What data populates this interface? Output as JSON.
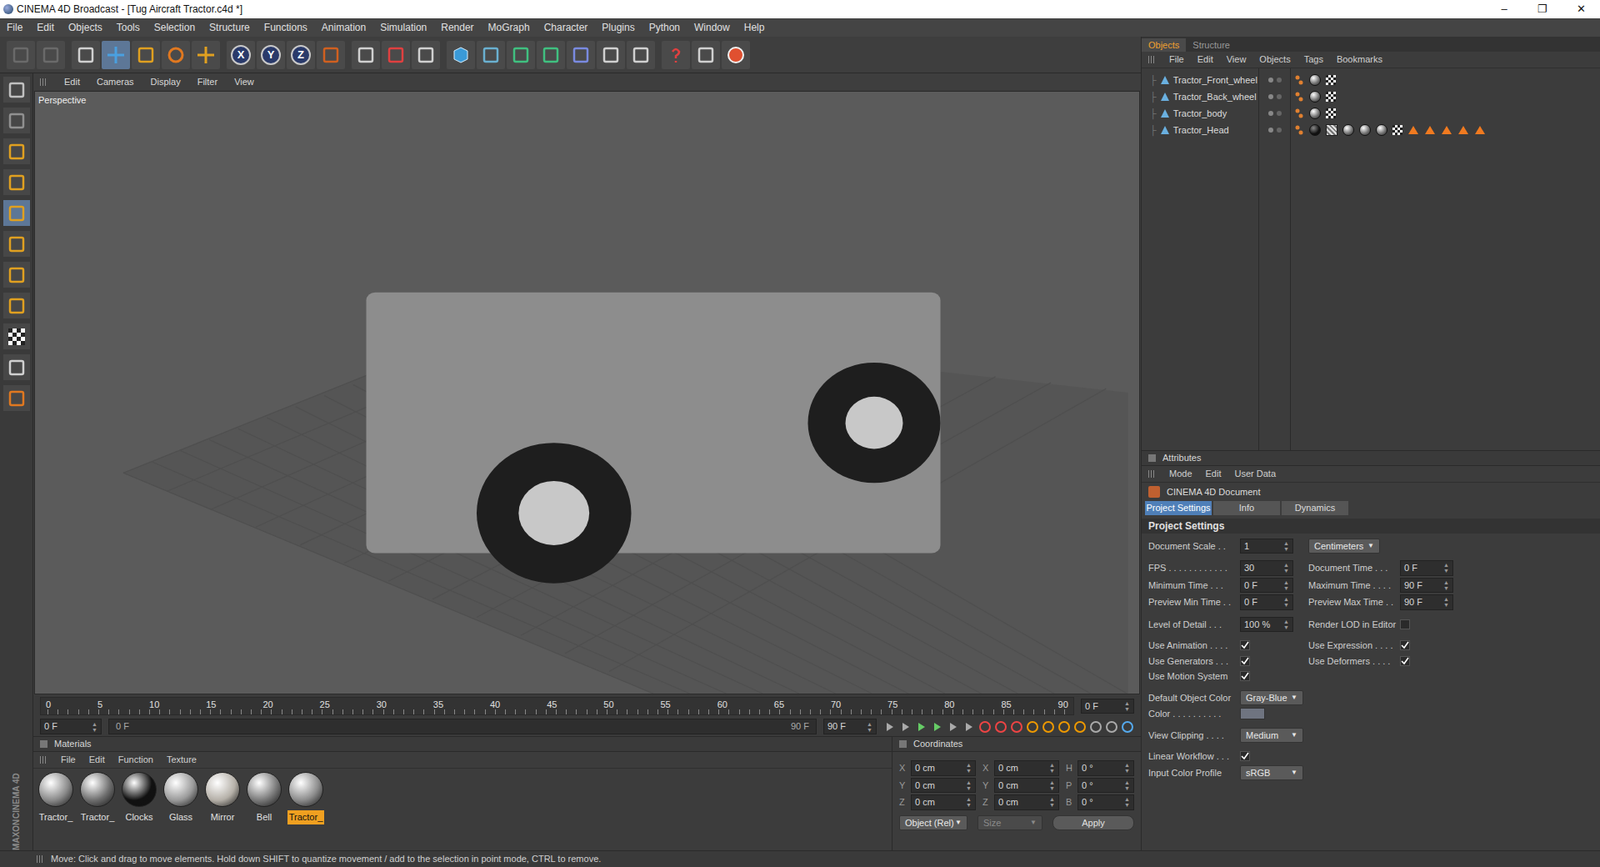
{
  "window": {
    "title": "CINEMA 4D Broadcast - [Tug Aircraft Tractor.c4d *]",
    "controls": [
      "–",
      "❐",
      "✕"
    ]
  },
  "menu": [
    "File",
    "Edit",
    "Objects",
    "Tools",
    "Selection",
    "Structure",
    "Functions",
    "Animation",
    "Simulation",
    "Render",
    "MoGraph",
    "Character",
    "Plugins",
    "Python",
    "Window",
    "Help"
  ],
  "toolbar": [
    {
      "kind": "undo",
      "label": "",
      "selected": false
    },
    {
      "kind": "redo",
      "label": "",
      "selected": false
    },
    {
      "kind": "select",
      "label": "",
      "selected": false
    },
    {
      "kind": "move",
      "label": "",
      "selected": true
    },
    {
      "kind": "scale",
      "label": "",
      "selected": false
    },
    {
      "kind": "rotate",
      "label": "",
      "selected": false
    },
    {
      "kind": "add",
      "label": "",
      "selected": false
    },
    {
      "kind": "axis",
      "label": "X",
      "selected": false
    },
    {
      "kind": "axis",
      "label": "Y",
      "selected": false
    },
    {
      "kind": "axis",
      "label": "Z",
      "selected": false
    },
    {
      "kind": "coords",
      "label": "",
      "selected": false
    },
    {
      "kind": "render-view",
      "label": "",
      "selected": false
    },
    {
      "kind": "render",
      "label": "",
      "selected": false
    },
    {
      "kind": "render-settings",
      "label": "",
      "selected": false
    },
    {
      "kind": "cube",
      "label": "",
      "selected": false
    },
    {
      "kind": "spline",
      "label": "",
      "selected": false
    },
    {
      "kind": "nurbs",
      "label": "",
      "selected": false
    },
    {
      "kind": "array",
      "label": "",
      "selected": false
    },
    {
      "kind": "deformer",
      "label": "",
      "selected": false
    },
    {
      "kind": "scene",
      "label": "",
      "selected": false
    },
    {
      "kind": "particles",
      "label": "",
      "selected": false
    },
    {
      "kind": "help",
      "label": "",
      "selected": false
    },
    {
      "kind": "table",
      "label": "",
      "selected": false
    },
    {
      "kind": "web",
      "label": "",
      "selected": false
    }
  ],
  "left_toolbar": [
    {
      "kind": "view",
      "selected": false
    },
    {
      "kind": "sculpt",
      "selected": false
    },
    {
      "kind": "points",
      "selected": false
    },
    {
      "kind": "edges",
      "selected": false
    },
    {
      "kind": "model",
      "selected": true
    },
    {
      "kind": "object",
      "selected": false
    },
    {
      "kind": "polygons",
      "selected": false
    },
    {
      "kind": "texture",
      "selected": false
    },
    {
      "kind": "checker",
      "selected": false
    },
    {
      "kind": "workplane",
      "selected": false
    },
    {
      "kind": "snap",
      "selected": false
    }
  ],
  "viewport": {
    "menu": [
      "Edit",
      "Cameras",
      "Display",
      "Filter",
      "View"
    ],
    "label": "Perspective"
  },
  "timeline": {
    "ticks": [
      "0",
      "5",
      "10",
      "15",
      "20",
      "25",
      "30",
      "35",
      "40",
      "45",
      "50",
      "55",
      "60",
      "65",
      "70",
      "75",
      "80",
      "85",
      "90"
    ],
    "current": "0 F",
    "start": "0 F",
    "range_start": "0 F",
    "range_end": "90 F",
    "end": "90 F"
  },
  "materials": {
    "title": "Materials",
    "menu": [
      "File",
      "Edit",
      "Function",
      "Texture"
    ],
    "items": [
      {
        "name": "Tractor_",
        "selected": false,
        "color": "#8a8a8a"
      },
      {
        "name": "Tractor_",
        "selected": false,
        "color": "#6e6e6e"
      },
      {
        "name": "Clocks",
        "selected": false,
        "color": "#111111"
      },
      {
        "name": "Glass",
        "selected": false,
        "color": "#9a9a9a"
      },
      {
        "name": "Mirror",
        "selected": false,
        "color": "#b5b0a8"
      },
      {
        "name": "Bell",
        "selected": false,
        "color": "#7a7a7a"
      },
      {
        "name": "Tractor_",
        "selected": true,
        "color": "#8c8c8c"
      }
    ]
  },
  "coordinates": {
    "title": "Coordinates",
    "rows": [
      {
        "a": "X",
        "av": "0 cm",
        "b": "X",
        "bv": "0 cm",
        "c": "H",
        "cv": "0 °"
      },
      {
        "a": "Y",
        "av": "0 cm",
        "b": "Y",
        "bv": "0 cm",
        "c": "P",
        "cv": "0 °"
      },
      {
        "a": "Z",
        "av": "0 cm",
        "b": "Z",
        "bv": "0 cm",
        "c": "B",
        "cv": "0 °"
      }
    ],
    "mode": "Object (Rel)",
    "size": "Size",
    "apply": "Apply"
  },
  "objects": {
    "tabs": [
      {
        "label": "Objects",
        "selected": true
      },
      {
        "label": "Structure",
        "selected": false
      }
    ],
    "menu": [
      "File",
      "Edit",
      "View",
      "Objects",
      "Tags",
      "Bookmarks"
    ],
    "items": [
      {
        "name": "Tractor_Front_wheel",
        "tags": [
          "phong",
          "material",
          "texture"
        ]
      },
      {
        "name": "Tractor_Back_wheel",
        "tags": [
          "phong",
          "material",
          "texture"
        ]
      },
      {
        "name": "Tractor_body",
        "tags": [
          "phong",
          "material",
          "texture"
        ]
      },
      {
        "name": "Tractor_Head",
        "tags": [
          "phong",
          "dark",
          "stripe",
          "material",
          "material",
          "material",
          "texture",
          "warning",
          "warning",
          "warning",
          "warning",
          "warning"
        ]
      }
    ]
  },
  "attributes": {
    "title": "Attributes",
    "menu": [
      "Mode",
      "Edit",
      "User Data"
    ],
    "document": "CINEMA 4D Document",
    "tabs": [
      {
        "label": "Project Settings",
        "selected": true
      },
      {
        "label": "Info",
        "selected": false
      },
      {
        "label": "Dynamics",
        "selected": false
      }
    ],
    "section": "Project Settings",
    "groups": [
      [
        [
          {
            "label": "Document Scale . .",
            "kind": "field",
            "value": "1",
            "checked": false
          },
          {
            "label": "",
            "kind": "dropdown",
            "value": "Centimeters",
            "checked": false
          }
        ]
      ],
      [
        [
          {
            "label": "FPS . . . . . . . . . . . .",
            "kind": "field",
            "value": "30",
            "checked": false
          },
          {
            "label": "Document Time . . .",
            "kind": "field",
            "value": "0 F",
            "checked": false
          }
        ],
        [
          {
            "label": "Minimum Time . . .",
            "kind": "field",
            "value": "0 F",
            "checked": false
          },
          {
            "label": "Maximum Time . . . .",
            "kind": "field",
            "value": "90 F",
            "checked": false
          }
        ],
        [
          {
            "label": "Preview Min Time . .",
            "kind": "field",
            "value": "0 F",
            "checked": false
          },
          {
            "label": "Preview Max Time . .",
            "kind": "field",
            "value": "90 F",
            "checked": false
          }
        ]
      ],
      [
        [
          {
            "label": "Level of Detail . . .",
            "kind": "field",
            "value": "100 %",
            "checked": false
          },
          {
            "label": "Render LOD in Editor",
            "kind": "check",
            "value": "",
            "checked": false
          }
        ]
      ],
      [
        [
          {
            "label": "Use Animation . . . .",
            "kind": "check",
            "value": "",
            "checked": true
          },
          {
            "label": "Use Expression . . . .",
            "kind": "check",
            "value": "",
            "checked": true
          }
        ],
        [
          {
            "label": "Use Generators . . .",
            "kind": "check",
            "value": "",
            "checked": true
          },
          {
            "label": "Use Deformers . . . .",
            "kind": "check",
            "value": "",
            "checked": true
          }
        ],
        [
          {
            "label": "Use Motion System",
            "kind": "check",
            "value": "",
            "checked": true
          }
        ]
      ],
      [
        [
          {
            "label": "Default Object Color",
            "kind": "dropdown",
            "value": "Gray-Blue",
            "checked": false
          }
        ],
        [
          {
            "label": "Color . . . . . . . . . .",
            "kind": "color",
            "value": "",
            "checked": false
          }
        ]
      ],
      [
        [
          {
            "label": "View Clipping . . . .",
            "kind": "dropdown",
            "value": "Medium",
            "checked": false
          }
        ]
      ],
      [
        [
          {
            "label": "Linear Workflow . . .",
            "kind": "check",
            "value": "",
            "checked": true
          }
        ],
        [
          {
            "label": "Input Color Profile",
            "kind": "dropdown",
            "value": "sRGB",
            "checked": false
          }
        ]
      ]
    ]
  },
  "status_bar": "Move: Click and drag to move elements. Hold down SHIFT to quantize movement / add to the selection in point mode, CTRL to remove.",
  "logo": [
    "MAXON",
    "CINEMA 4D"
  ]
}
